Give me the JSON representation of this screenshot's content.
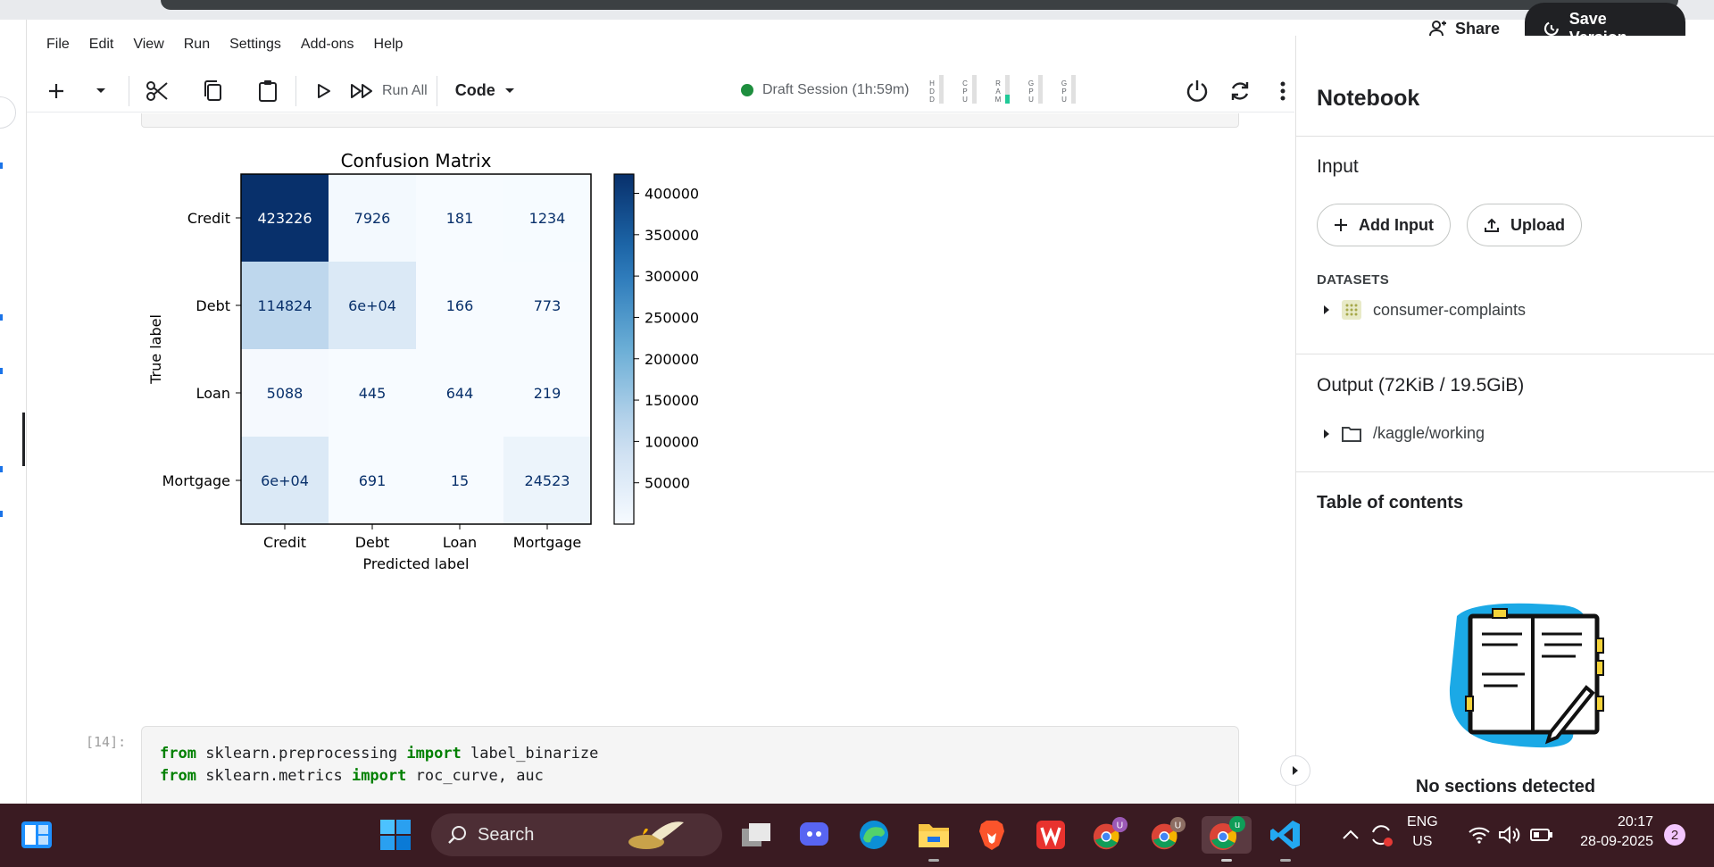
{
  "menu": [
    "File",
    "Edit",
    "View",
    "Run",
    "Settings",
    "Add-ons",
    "Help"
  ],
  "header": {
    "share_label": "Share",
    "save_label": "Save Version"
  },
  "toolbar": {
    "run_all": "Run All",
    "cell_type": "Code",
    "session": "Draft Session (1h:59m)",
    "meters": [
      {
        "label": "H\nD\nD",
        "level": 0.0
      },
      {
        "label": "C\nP\nU",
        "level": 0.0
      },
      {
        "label": "R\nA\nM",
        "level": 0.3
      },
      {
        "label": "G\nP\nU",
        "level": 0.0
      },
      {
        "label": "G\nP\nU",
        "level": 0.0
      }
    ]
  },
  "chart_data": {
    "type": "heatmap",
    "title": "Confusion Matrix",
    "xlabel": "Predicted label",
    "ylabel": "True label",
    "x_categories": [
      "Credit",
      "Debt",
      "Loan",
      "Mortgage"
    ],
    "y_categories": [
      "Credit",
      "Debt",
      "Loan",
      "Mortgage"
    ],
    "cell_labels": [
      [
        "423226",
        "7926",
        "181",
        "1234"
      ],
      [
        "114824",
        "6e+04",
        "166",
        "773"
      ],
      [
        "5088",
        "445",
        "644",
        "219"
      ],
      [
        "6e+04",
        "691",
        "15",
        "24523"
      ]
    ],
    "values": [
      [
        423226,
        7926,
        181,
        1234
      ],
      [
        114824,
        60000,
        166,
        773
      ],
      [
        5088,
        445,
        644,
        219
      ],
      [
        60000,
        691,
        15,
        24523
      ]
    ],
    "colormap": "Blues",
    "colorbar_ticks": [
      "400000",
      "350000",
      "300000",
      "250000",
      "200000",
      "150000",
      "100000",
      "50000"
    ],
    "colorbar_values": [
      400000,
      350000,
      300000,
      250000,
      200000,
      150000,
      100000,
      50000
    ],
    "vmin": 15,
    "vmax": 423226
  },
  "cell": {
    "number": "[14]:",
    "code_lines": [
      [
        {
          "k": true,
          "t": "from"
        },
        {
          "k": false,
          "t": " sklearn.preprocessing "
        },
        {
          "k": true,
          "t": "import"
        },
        {
          "k": false,
          "t": " label_binarize"
        }
      ],
      [
        {
          "k": true,
          "t": "from"
        },
        {
          "k": false,
          "t": " sklearn.metrics "
        },
        {
          "k": true,
          "t": "import"
        },
        {
          "k": false,
          "t": " roc_curve, auc"
        }
      ]
    ]
  },
  "panel": {
    "title": "Notebook",
    "input_heading": "Input",
    "add_input": "Add Input",
    "upload": "Upload",
    "datasets_label": "DATASETS",
    "dataset_name": "consumer-complaints",
    "output_heading": "Output (72KiB / 19.5GiB)",
    "output_path": "/kaggle/working",
    "toc_heading": "Table of contents",
    "no_sections": "No sections detected"
  },
  "taskbar": {
    "search": "Search",
    "lang_top": "ENG",
    "lang_bottom": "US",
    "time": "20:17",
    "date": "28-09-2025",
    "notif_count": "2",
    "badges": [
      "U",
      "U",
      "u"
    ]
  },
  "colors": {
    "accent_dark": "#202124",
    "session_green": "#1e8e3e",
    "taskbar_bg": "#3a1b22",
    "keyword": "#008000"
  }
}
